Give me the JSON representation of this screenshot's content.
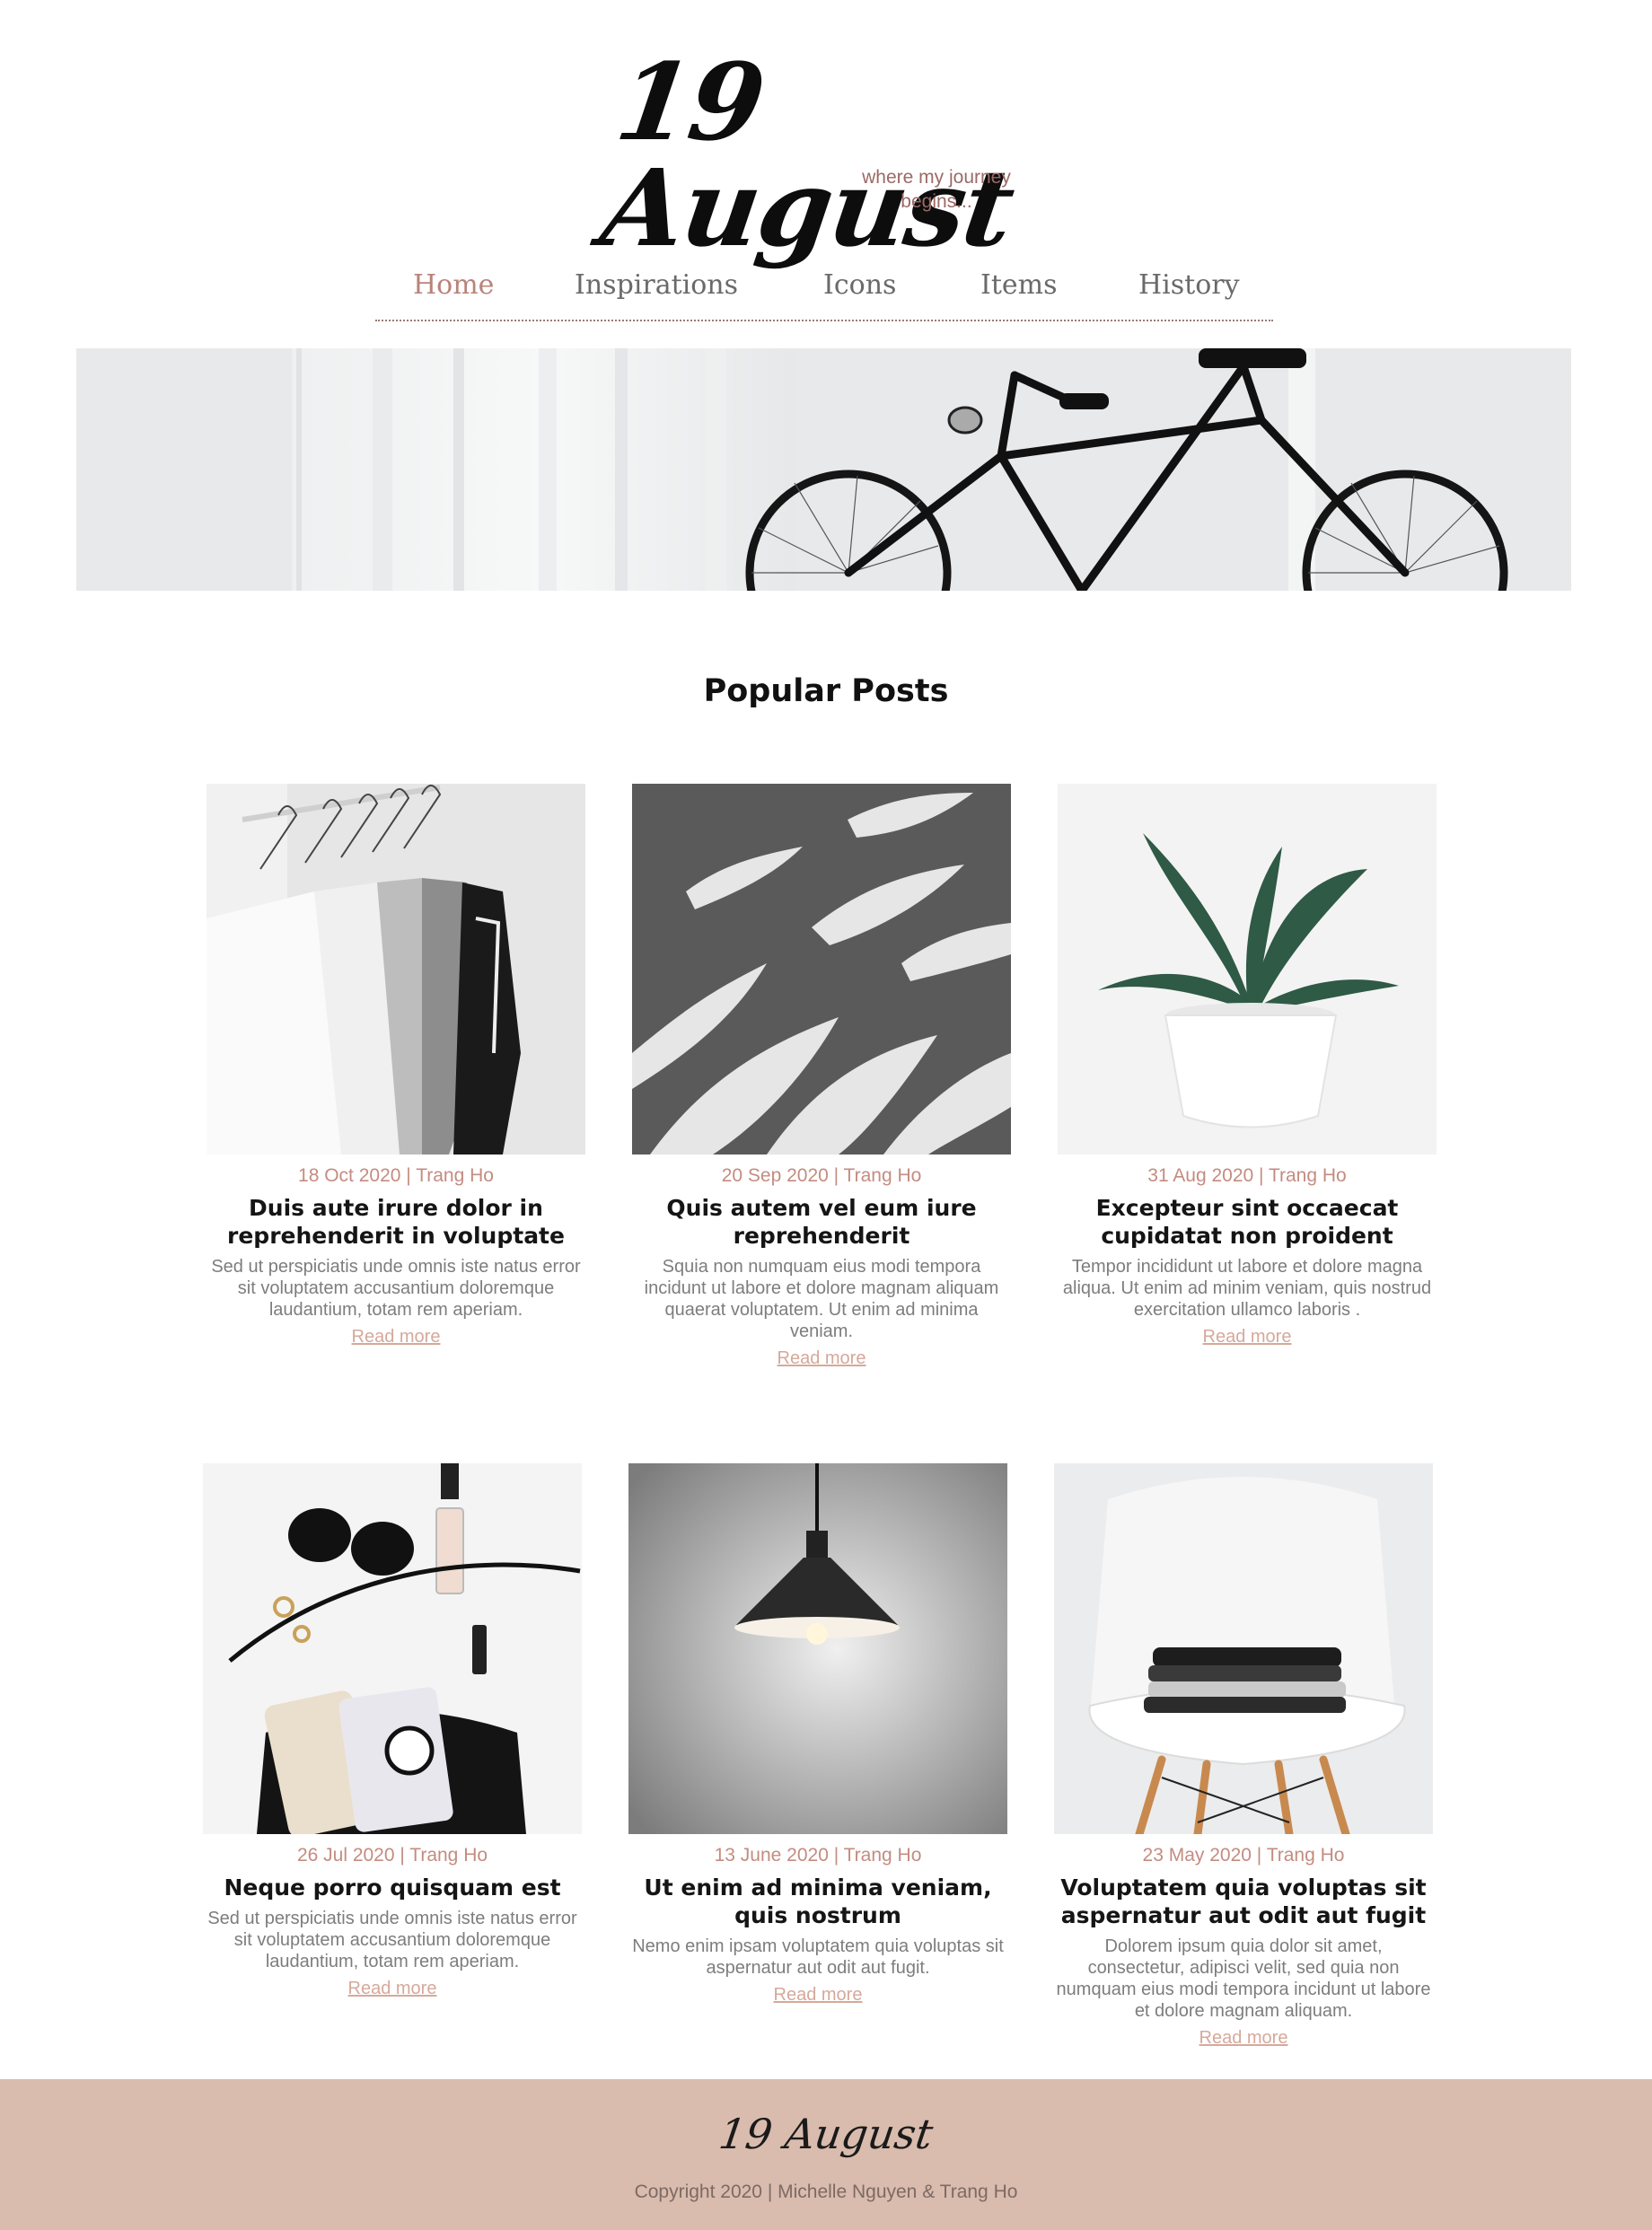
{
  "logo": {
    "text": "19 August",
    "tagline": "where my journey begins..."
  },
  "nav": {
    "items": [
      {
        "label": "Home",
        "active": true
      },
      {
        "label": "Inspirations",
        "active": false
      },
      {
        "label": "Icons",
        "active": false
      },
      {
        "label": "Items",
        "active": false
      },
      {
        "label": "History",
        "active": false
      }
    ]
  },
  "section": {
    "title": "Popular Posts"
  },
  "posts": [
    {
      "meta": "18 Oct 2020 | Trang Ho",
      "title": "Duis aute irure dolor in reprehenderit in voluptate",
      "excerpt": "Sed ut perspiciatis unde omnis iste natus error sit voluptatem accusantium doloremque laudantium, totam rem aperiam.",
      "more": "Read more"
    },
    {
      "meta": "20 Sep 2020 | Trang Ho",
      "title": "Quis autem vel eum iure reprehenderit",
      "excerpt": "Squia non numquam eius modi tempora incidunt ut labore et dolore magnam aliquam quaerat voluptatem. Ut enim ad minima veniam.",
      "more": "Read more"
    },
    {
      "meta": "31 Aug 2020 | Trang Ho",
      "title": "Excepteur sint occaecat cupidatat non proident",
      "excerpt": "Tempor incididunt ut labore et dolore magna aliqua. Ut enim ad minim veniam, quis nostrud exercitation ullamco laboris .",
      "more": "Read more"
    },
    {
      "meta": "26 Jul 2020 | Trang Ho",
      "title": "Neque porro quisquam est",
      "excerpt": "Sed ut perspiciatis unde omnis iste natus error sit voluptatem accusantium doloremque laudantium, totam rem aperiam.",
      "more": "Read more"
    },
    {
      "meta": "13 June 2020 | Trang Ho",
      "title": "Ut enim ad minima veniam, quis nostrum",
      "excerpt": "Nemo enim ipsam voluptatem quia voluptas sit aspernatur aut odit aut fugit.",
      "more": "Read more"
    },
    {
      "meta": "23 May 2020 | Trang Ho",
      "title": "Voluptatem quia voluptas sit aspernatur aut odit aut fugit",
      "excerpt": "Dolorem ipsum quia dolor sit amet, consectetur, adipisci velit, sed quia non numquam eius modi tempora incidunt ut labore et dolore magnam aliquam.",
      "more": "Read more"
    }
  ],
  "footer": {
    "logo": "19 August",
    "copyright": "Copyright 2020 | Michelle Nguyen & Trang Ho"
  },
  "colors": {
    "accent": "#b8837a",
    "link": "#d6a89b",
    "footer_bg": "#d9bcad"
  }
}
